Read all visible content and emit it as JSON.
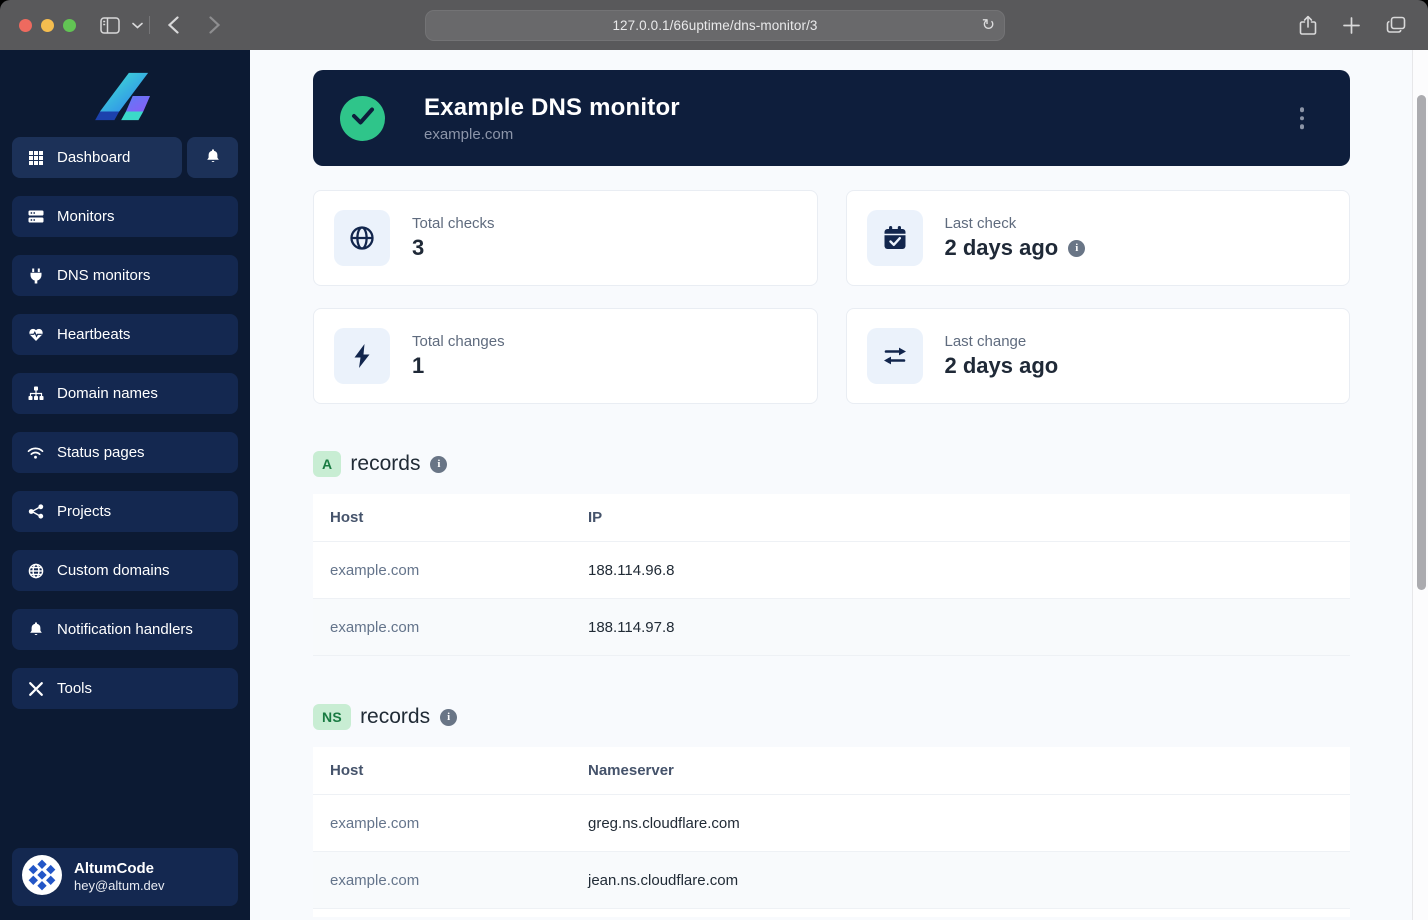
{
  "browser": {
    "url": "127.0.0.1/66uptime/dns-monitor/3",
    "reload_glyph": "↻",
    "traffic_colors": {
      "close": "#ee6a5f",
      "minimize": "#f5bd4f",
      "zoom": "#62c454"
    }
  },
  "sidebar": {
    "items": [
      {
        "label": "Dashboard",
        "icon": "grid-icon",
        "active": true
      },
      {
        "label": "Monitors",
        "icon": "server-icon"
      },
      {
        "label": "DNS monitors",
        "icon": "plug-icon"
      },
      {
        "label": "Heartbeats",
        "icon": "heart-pulse-icon"
      },
      {
        "label": "Domain names",
        "icon": "sitemap-icon"
      },
      {
        "label": "Status pages",
        "icon": "wifi-icon"
      },
      {
        "label": "Projects",
        "icon": "share-nodes-icon"
      },
      {
        "label": "Custom domains",
        "icon": "globe-icon"
      },
      {
        "label": "Notification handlers",
        "icon": "bell-icon"
      },
      {
        "label": "Tools",
        "icon": "tools-icon"
      }
    ],
    "user": {
      "name": "AltumCode",
      "email": "hey@altum.dev"
    }
  },
  "monitor_header": {
    "title": "Example DNS monitor",
    "subtitle": "example.com",
    "status": "up",
    "status_color": "#2fc58a"
  },
  "stats": [
    {
      "label": "Total checks",
      "value": "3",
      "icon": "globe-icon",
      "has_info": false
    },
    {
      "label": "Last check",
      "value": "2 days ago",
      "icon": "calendar-check-icon",
      "has_info": true
    },
    {
      "label": "Total changes",
      "value": "1",
      "icon": "bolt-icon",
      "has_info": false
    },
    {
      "label": "Last change",
      "value": "2 days ago",
      "icon": "swap-arrows-icon",
      "has_info": false
    }
  ],
  "info_glyph": "i",
  "record_sections": [
    {
      "badge": "A",
      "title": "records",
      "columns": {
        "c1": "Host",
        "c2": "IP"
      },
      "rows": [
        {
          "host": "example.com",
          "value": "188.114.96.8"
        },
        {
          "host": "example.com",
          "value": "188.114.97.8"
        }
      ]
    },
    {
      "badge": "NS",
      "title": "records",
      "columns": {
        "c1": "Host",
        "c2": "Nameserver"
      },
      "rows": [
        {
          "host": "example.com",
          "value": "greg.ns.cloudflare.com"
        },
        {
          "host": "example.com",
          "value": "jean.ns.cloudflare.com"
        }
      ]
    }
  ],
  "colors": {
    "sidebar_bg": "#0c1a33",
    "nav_item_bg": "#142850",
    "hero_bg": "#0e1e3c",
    "page_bg": "#f8fafd",
    "badge_bg": "#c8edd3",
    "badge_text": "#197b42",
    "status_green": "#2fc58a"
  }
}
